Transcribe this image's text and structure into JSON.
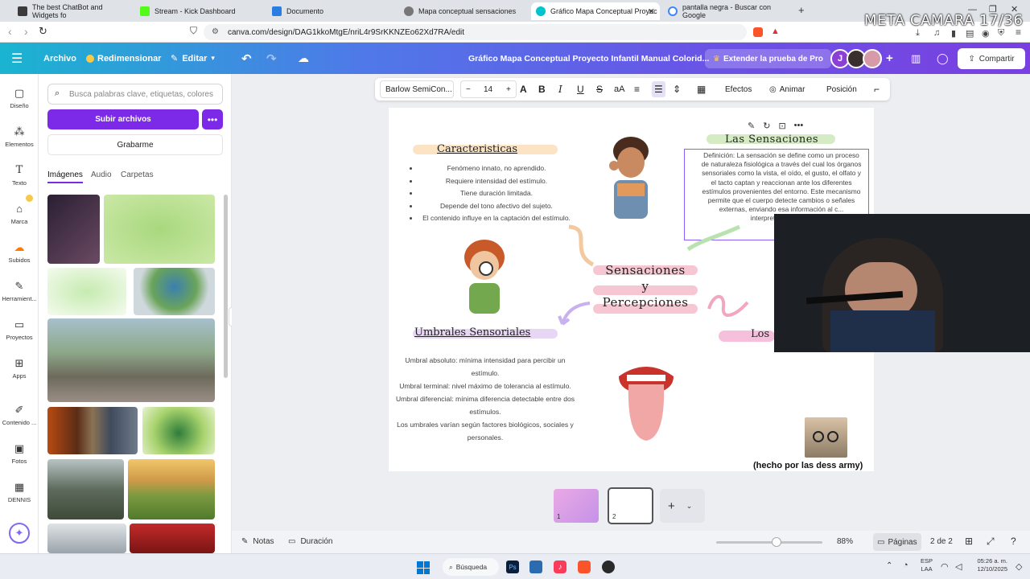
{
  "browser": {
    "tabs": [
      {
        "title": "The best ChatBot and Widgets fo",
        "color": "#3b3b3b"
      },
      {
        "title": "Stream - Kick Dashboard",
        "color": "#53fc18"
      },
      {
        "title": "Documento",
        "color": "#2a7de1"
      },
      {
        "title": "Mapa conceptual sensaciones",
        "color": "#777777"
      },
      {
        "title": "Gráfico Mapa Conceptual Proyec",
        "color": "#00c4cc"
      },
      {
        "title": "pantalla negra - Buscar con Google",
        "color": "#4285f4"
      }
    ],
    "url": "canva.com/design/DAG1kkoMtgE/nriL4r9SrKKNZEo62Xd7RA/edit",
    "overlay_text": "META CAMARA 17/36"
  },
  "canva_header": {
    "file": "Archivo",
    "resize": "Redimensionar",
    "edit": "Editar",
    "doc_title": "Gráfico Mapa Conceptual Proyecto Infantil Manual Colorid...",
    "trial": "Extender la prueba de Pro",
    "share": "Compartir",
    "avatar_initial": "J"
  },
  "left_rail": [
    {
      "label": "Diseño",
      "icon": "layout-icon"
    },
    {
      "label": "Elementos",
      "icon": "shapes-icon"
    },
    {
      "label": "Texto",
      "icon": "text-icon"
    },
    {
      "label": "Marca",
      "icon": "brand-icon"
    },
    {
      "label": "Subidos",
      "icon": "cloud-upload-icon"
    },
    {
      "label": "Herramient...",
      "icon": "tools-icon"
    },
    {
      "label": "Proyectos",
      "icon": "folder-icon"
    },
    {
      "label": "Apps",
      "icon": "apps-icon"
    },
    {
      "label": "Contenido ...",
      "icon": "magic-content-icon"
    },
    {
      "label": "Fotos",
      "icon": "photo-icon"
    },
    {
      "label": "DENNIS",
      "icon": "dennis-icon"
    }
  ],
  "side_panel": {
    "search_placeholder": "Busca palabras clave, etiquetas, colores",
    "upload": "Subir archivos",
    "record": "Grabarme",
    "tabs": [
      "Imágenes",
      "Audio",
      "Carpetas"
    ]
  },
  "toolbar": {
    "font": "Barlow SemiCon...",
    "size": "14",
    "effects": "Efectos",
    "animate": "Animar",
    "position": "Posición"
  },
  "design": {
    "caracteristicas_title": "Caracteristicas",
    "caracteristicas": [
      "Fenómeno innato, no aprendido.",
      "Requiere intensidad del estímulo.",
      "Tiene duración limitada.",
      "Depende del tono afectivo del sujeto.",
      "El contenido influye en la captación del estímulo."
    ],
    "sensaciones_title": "Las Sensaciones",
    "definicion": "Definición: La sensación se define como un proceso de naturaleza fisiológica a través del cual los órganos sensoriales como la vista, el oído, el gusto, el olfato y el tacto captan y reaccionan ante los diferentes estímulos provenientes del entorno. Este mecanismo permite que el cuerpo detecte cambios o señales externas, enviando esa información al c... interpretación (Mat...",
    "center_line1": "Sensaciones",
    "center_line2": "y",
    "center_line3": "Percepciones",
    "umbrales_title": "Umbrales Sensoriales",
    "umbrales": [
      "Umbral absoluto: mínima intensidad para percibir un estímulo.",
      "Umbral terminal: nivel máximo de tolerancia al estímulo.",
      "Umbral diferencial: mínima diferencia detectable entre dos estímulos.",
      "Los umbrales varían según factores biológicos, sociales y personales."
    ],
    "los_partial": "Los",
    "credit": "(hecho por las dess army)"
  },
  "bottom": {
    "notes": "Notas",
    "duration": "Duración",
    "zoom": "88%",
    "pages": "Páginas",
    "page_count": "2 de 2",
    "page_thumb_1": "1",
    "page_thumb_2": "2"
  },
  "taskbar": {
    "search": "Búsqueda",
    "lang_top": "ESP",
    "lang_bottom": "LAA",
    "time": "05:26 a. m.",
    "date": "12/10/2025"
  }
}
